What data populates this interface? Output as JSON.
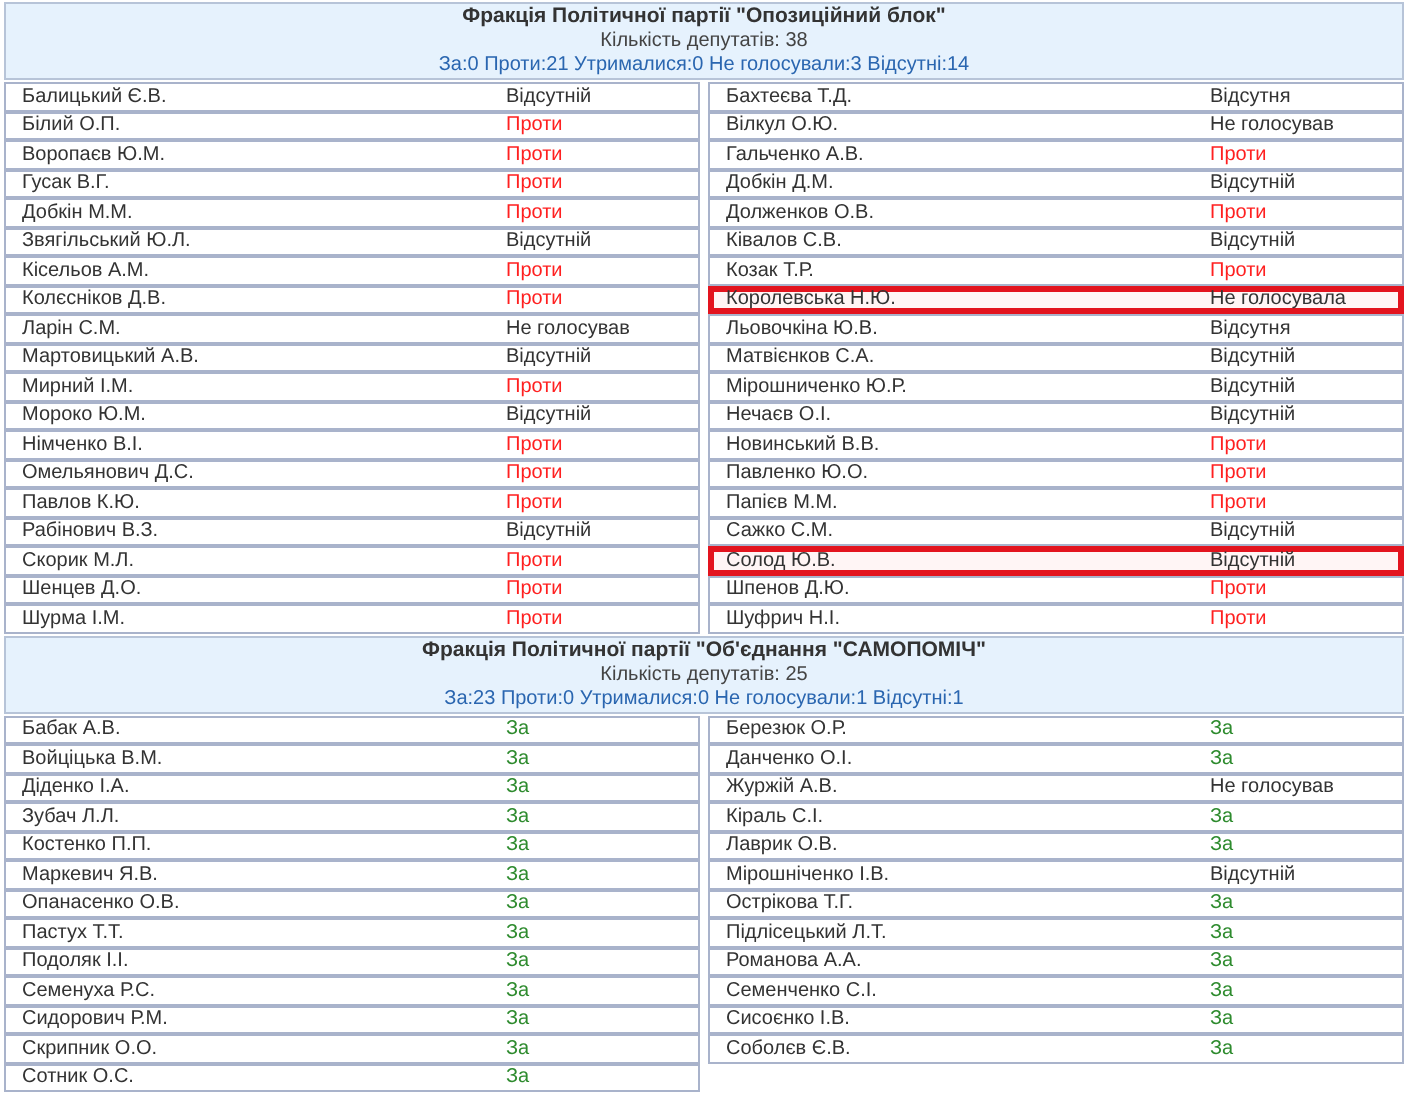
{
  "factions": [
    {
      "title": "Фракція Політичної партії \"Опозиційний блок\"",
      "count": "Кількість депутатів: 38",
      "summary": "За:0 Проти:21 Утрималися:0 Не голосували:3 Відсутні:14",
      "columns": [
        [
          {
            "name": "Балицький Є.В.",
            "vote": "Відсутній",
            "kind": "absent",
            "highlighted": false
          },
          {
            "name": "Білий О.П.",
            "vote": "Проти",
            "kind": "against",
            "highlighted": false
          },
          {
            "name": "Воропаєв Ю.М.",
            "vote": "Проти",
            "kind": "against",
            "highlighted": false
          },
          {
            "name": "Гусак В.Г.",
            "vote": "Проти",
            "kind": "against",
            "highlighted": false
          },
          {
            "name": "Добкін М.М.",
            "vote": "Проти",
            "kind": "against",
            "highlighted": false
          },
          {
            "name": "Звягільський Ю.Л.",
            "vote": "Відсутній",
            "kind": "absent",
            "highlighted": false
          },
          {
            "name": "Кісельов А.М.",
            "vote": "Проти",
            "kind": "against",
            "highlighted": false
          },
          {
            "name": "Колєсніков Д.В.",
            "vote": "Проти",
            "kind": "against",
            "highlighted": false
          },
          {
            "name": "Ларін С.М.",
            "vote": "Не голосував",
            "kind": "not_voted",
            "highlighted": false
          },
          {
            "name": "Мартовицький А.В.",
            "vote": "Відсутній",
            "kind": "absent",
            "highlighted": false
          },
          {
            "name": "Мирний І.М.",
            "vote": "Проти",
            "kind": "against",
            "highlighted": false
          },
          {
            "name": "Мороко Ю.М.",
            "vote": "Відсутній",
            "kind": "absent",
            "highlighted": false
          },
          {
            "name": "Німченко В.І.",
            "vote": "Проти",
            "kind": "against",
            "highlighted": false
          },
          {
            "name": "Омельянович Д.С.",
            "vote": "Проти",
            "kind": "against",
            "highlighted": false
          },
          {
            "name": "Павлов К.Ю.",
            "vote": "Проти",
            "kind": "against",
            "highlighted": false
          },
          {
            "name": "Рабінович В.З.",
            "vote": "Відсутній",
            "kind": "absent",
            "highlighted": false
          },
          {
            "name": "Скорик М.Л.",
            "vote": "Проти",
            "kind": "against",
            "highlighted": false
          },
          {
            "name": "Шенцев Д.О.",
            "vote": "Проти",
            "kind": "against",
            "highlighted": false
          },
          {
            "name": "Шурма І.М.",
            "vote": "Проти",
            "kind": "against",
            "highlighted": false
          }
        ],
        [
          {
            "name": "Бахтеєва Т.Д.",
            "vote": "Відсутня",
            "kind": "absent",
            "highlighted": false
          },
          {
            "name": "Вілкул О.Ю.",
            "vote": "Не голосував",
            "kind": "not_voted",
            "highlighted": false
          },
          {
            "name": "Гальченко А.В.",
            "vote": "Проти",
            "kind": "against",
            "highlighted": false
          },
          {
            "name": "Добкін Д.М.",
            "vote": "Відсутній",
            "kind": "absent",
            "highlighted": false
          },
          {
            "name": "Долженков О.В.",
            "vote": "Проти",
            "kind": "against",
            "highlighted": false
          },
          {
            "name": "Ківалов С.В.",
            "vote": "Відсутній",
            "kind": "absent",
            "highlighted": false
          },
          {
            "name": "Козак Т.Р.",
            "vote": "Проти",
            "kind": "against",
            "highlighted": false
          },
          {
            "name": "Королевська Н.Ю.",
            "vote": "Не голосувала",
            "kind": "not_voted",
            "highlighted": true
          },
          {
            "name": "Льовочкіна Ю.В.",
            "vote": "Відсутня",
            "kind": "absent",
            "highlighted": false
          },
          {
            "name": "Матвієнков С.А.",
            "vote": "Відсутній",
            "kind": "absent",
            "highlighted": false
          },
          {
            "name": "Мірошниченко Ю.Р.",
            "vote": "Відсутній",
            "kind": "absent",
            "highlighted": false
          },
          {
            "name": "Нечаєв О.І.",
            "vote": "Відсутній",
            "kind": "absent",
            "highlighted": false
          },
          {
            "name": "Новинський В.В.",
            "vote": "Проти",
            "kind": "against",
            "highlighted": false
          },
          {
            "name": "Павленко Ю.О.",
            "vote": "Проти",
            "kind": "against",
            "highlighted": false
          },
          {
            "name": "Папієв М.М.",
            "vote": "Проти",
            "kind": "against",
            "highlighted": false
          },
          {
            "name": "Сажко С.М.",
            "vote": "Відсутній",
            "kind": "absent",
            "highlighted": false
          },
          {
            "name": "Солод Ю.В.",
            "vote": "Відсутній",
            "kind": "absent",
            "highlighted": true
          },
          {
            "name": "Шпенов Д.Ю.",
            "vote": "Проти",
            "kind": "against",
            "highlighted": false
          },
          {
            "name": "Шуфрич Н.І.",
            "vote": "Проти",
            "kind": "against",
            "highlighted": false
          }
        ]
      ]
    },
    {
      "title": "Фракція Політичної партії \"Об'єднання \"САМОПОМІЧ\"",
      "count": "Кількість депутатів: 25",
      "summary": "За:23 Проти:0 Утрималися:0 Не голосували:1 Відсутні:1",
      "columns": [
        [
          {
            "name": "Бабак А.В.",
            "vote": "За",
            "kind": "for",
            "highlighted": false
          },
          {
            "name": "Войціцька В.М.",
            "vote": "За",
            "kind": "for",
            "highlighted": false
          },
          {
            "name": "Діденко І.А.",
            "vote": "За",
            "kind": "for",
            "highlighted": false
          },
          {
            "name": "Зубач Л.Л.",
            "vote": "За",
            "kind": "for",
            "highlighted": false
          },
          {
            "name": "Костенко П.П.",
            "vote": "За",
            "kind": "for",
            "highlighted": false
          },
          {
            "name": "Маркевич Я.В.",
            "vote": "За",
            "kind": "for",
            "highlighted": false
          },
          {
            "name": "Опанасенко О.В.",
            "vote": "За",
            "kind": "for",
            "highlighted": false
          },
          {
            "name": "Пастух Т.Т.",
            "vote": "За",
            "kind": "for",
            "highlighted": false
          },
          {
            "name": "Подоляк І.І.",
            "vote": "За",
            "kind": "for",
            "highlighted": false
          },
          {
            "name": "Семенуха Р.С.",
            "vote": "За",
            "kind": "for",
            "highlighted": false
          },
          {
            "name": "Сидорович Р.М.",
            "vote": "За",
            "kind": "for",
            "highlighted": false
          },
          {
            "name": "Скрипник О.О.",
            "vote": "За",
            "kind": "for",
            "highlighted": false
          },
          {
            "name": "Сотник О.С.",
            "vote": "За",
            "kind": "for",
            "highlighted": false
          }
        ],
        [
          {
            "name": "Березюк О.Р.",
            "vote": "За",
            "kind": "for",
            "highlighted": false
          },
          {
            "name": "Данченко О.І.",
            "vote": "За",
            "kind": "for",
            "highlighted": false
          },
          {
            "name": "Журжій А.В.",
            "vote": "Не голосував",
            "kind": "not_voted",
            "highlighted": false
          },
          {
            "name": "Кіраль С.І.",
            "vote": "За",
            "kind": "for",
            "highlighted": false
          },
          {
            "name": "Лаврик О.В.",
            "vote": "За",
            "kind": "for",
            "highlighted": false
          },
          {
            "name": "Мірошніченко І.В.",
            "vote": "Відсутній",
            "kind": "absent",
            "highlighted": false
          },
          {
            "name": "Острікова Т.Г.",
            "vote": "За",
            "kind": "for",
            "highlighted": false
          },
          {
            "name": "Підлісецький Л.Т.",
            "vote": "За",
            "kind": "for",
            "highlighted": false
          },
          {
            "name": "Романова А.А.",
            "vote": "За",
            "kind": "for",
            "highlighted": false
          },
          {
            "name": "Семенченко С.І.",
            "vote": "За",
            "kind": "for",
            "highlighted": false
          },
          {
            "name": "Сисоєнко І.В.",
            "vote": "За",
            "kind": "for",
            "highlighted": false
          },
          {
            "name": "Соболєв Є.В.",
            "vote": "За",
            "kind": "for",
            "highlighted": false
          }
        ]
      ]
    }
  ]
}
